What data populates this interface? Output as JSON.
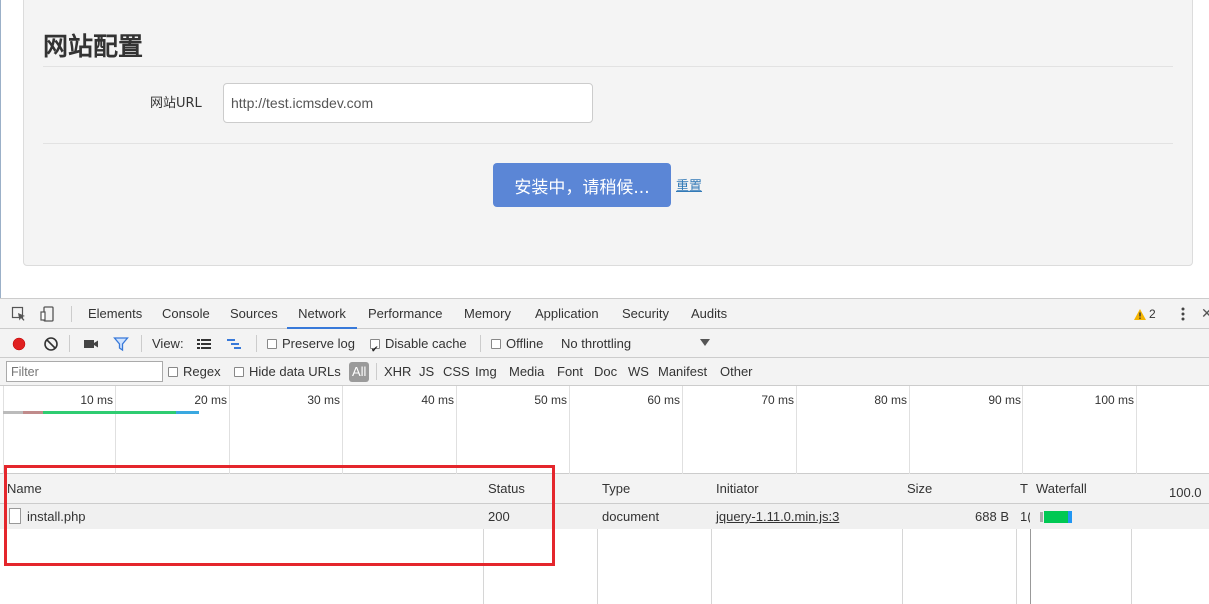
{
  "page": {
    "title": "网站配置",
    "url_label": "网站URL",
    "url_value": "http://test.icmsdev.com",
    "install_button": "安装中，请稍候...",
    "reset_link": "重置"
  },
  "devtools": {
    "tabs": [
      "Elements",
      "Console",
      "Sources",
      "Network",
      "Performance",
      "Memory",
      "Application",
      "Security",
      "Audits"
    ],
    "active_tab": "Network",
    "warning_count": "2",
    "toolbar": {
      "view_label": "View:",
      "preserve_log": "Preserve log",
      "disable_cache": "Disable cache",
      "offline": "Offline",
      "throttling": "No throttling"
    },
    "filter": {
      "placeholder": "Filter",
      "regex": "Regex",
      "hide_data_urls": "Hide data URLs",
      "types": [
        "All",
        "XHR",
        "JS",
        "CSS",
        "Img",
        "Media",
        "Font",
        "Doc",
        "WS",
        "Manifest",
        "Other"
      ]
    },
    "overview": {
      "ticks": [
        "10 ms",
        "20 ms",
        "30 ms",
        "40 ms",
        "50 ms",
        "60 ms",
        "70 ms",
        "80 ms",
        "90 ms",
        "100 ms"
      ]
    },
    "table": {
      "headers": {
        "name": "Name",
        "status": "Status",
        "type": "Type",
        "initiator": "Initiator",
        "size": "Size",
        "time": "T",
        "waterfall": "Waterfall",
        "waterfall_scale": "100.0"
      },
      "rows": [
        {
          "name": "install.php",
          "status": "200",
          "type": "document",
          "initiator": "jquery-1.11.0.min.js:3",
          "size": "688 B",
          "time": "1("
        }
      ]
    }
  },
  "colors": {
    "primary_button": "#5b86d6",
    "link": "#337ab7",
    "active_tab_underline": "#3879d9",
    "highlight_box": "#e4262c",
    "record_dot": "#e02020",
    "waterfall_receive": "#00c853",
    "waterfall_download": "#2196f3"
  }
}
